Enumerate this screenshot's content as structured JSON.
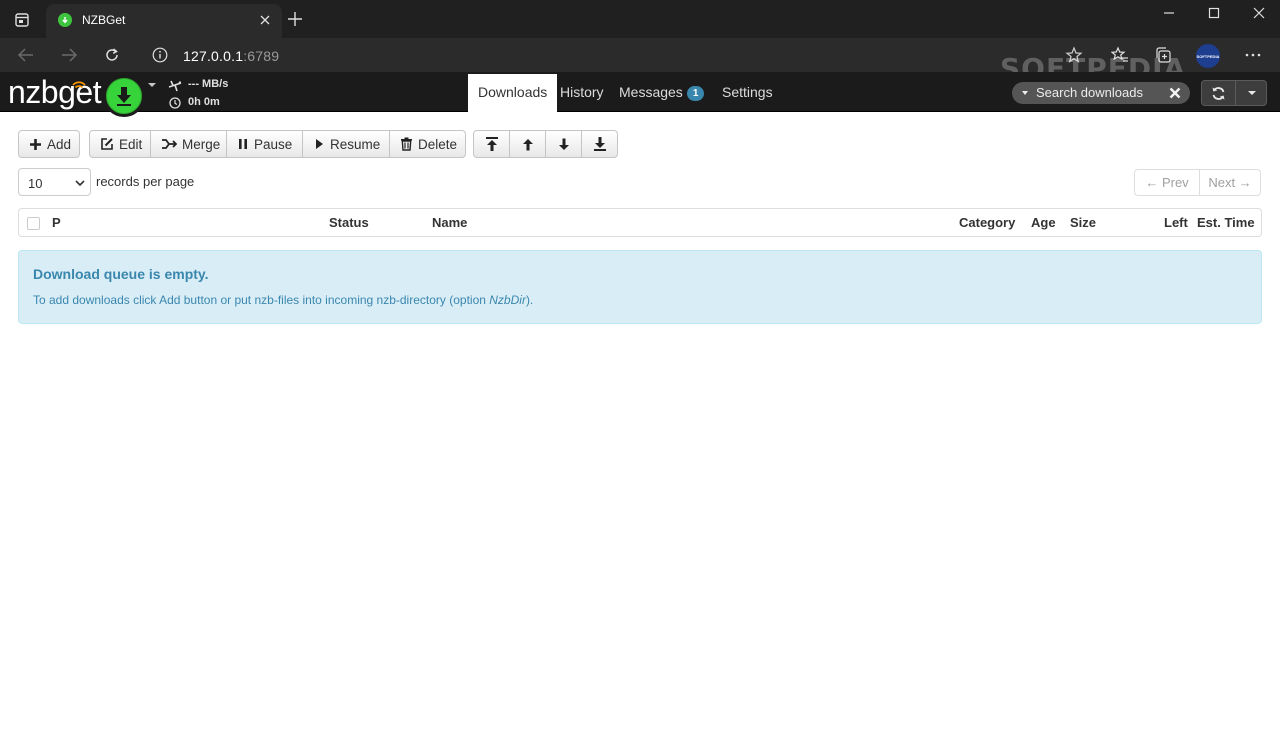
{
  "browser": {
    "tab": {
      "title": "NZBGet"
    },
    "url": {
      "host": "127.0.0.1",
      "port": ":6789"
    },
    "profile_label": "SOFTPEDIA",
    "watermark": "SOFTPEDIA"
  },
  "header": {
    "brand": "nzbget",
    "speed": "--- MB/s",
    "time_left": "0h 0m",
    "tabs": [
      {
        "label": "Downloads",
        "active": true
      },
      {
        "label": "History"
      },
      {
        "label": "Messages",
        "badge": "1"
      },
      {
        "label": "Settings"
      }
    ],
    "search_placeholder": "Search downloads"
  },
  "toolbar": {
    "add": "Add",
    "edit": "Edit",
    "merge": "Merge",
    "pause": "Pause",
    "resume": "Resume",
    "delete": "Delete"
  },
  "paging": {
    "records_value": "10",
    "records_label": "records per page",
    "prev": "← Prev",
    "next": "Next →"
  },
  "table": {
    "columns": [
      "P",
      "Status",
      "Name",
      "Category",
      "Age",
      "Size",
      "Left",
      "Est. Time"
    ]
  },
  "empty": {
    "title": "Download queue is empty.",
    "text_before": "To add downloads click Add button or put nzb-files into incoming nzb-directory (option ",
    "option": "NzbDir",
    "text_after": ")."
  },
  "colors": {
    "accent_green": "#36d33a",
    "badge_blue": "#3a87ad",
    "alert_bg": "#d9edf7"
  }
}
